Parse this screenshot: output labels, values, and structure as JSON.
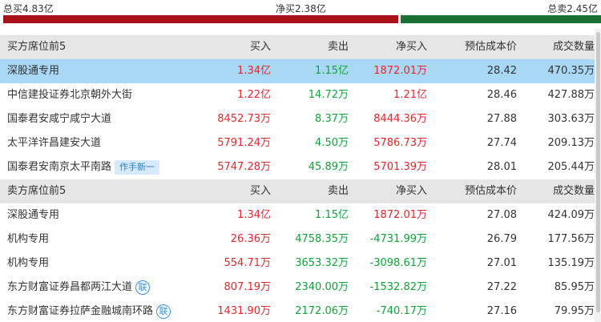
{
  "summary": {
    "total_buy": "总买4.83亿",
    "net_buy": "净买2.38亿",
    "total_sell": "总卖2.45亿",
    "buy_fraction": 0.664,
    "sell_fraction": 0.336
  },
  "colors": {
    "up": "#e8262d",
    "down": "#11a33a",
    "highlight": "#a9d8f5",
    "header": "#e6e6e6"
  },
  "buy_table": {
    "headers": {
      "name": "买方席位前5",
      "buy": "买入",
      "sell": "卖出",
      "net": "净买入",
      "cost": "预估成本价",
      "volume": "成交数量"
    },
    "rows": [
      {
        "name": "深股通专用",
        "buy": "1.34亿",
        "sell": "1.15亿",
        "net": "1872.01万",
        "cost": "28.42",
        "volume": "470.35万"
      },
      {
        "name": "中信建投证券北京朝外大街",
        "buy": "1.22亿",
        "sell": "14.72万",
        "net": "1.21亿",
        "cost": "28.46",
        "volume": "427.88万"
      },
      {
        "name": "国泰君安咸宁咸宁大道",
        "buy": "8452.73万",
        "sell": "8.37万",
        "net": "8444.36万",
        "cost": "27.88",
        "volume": "303.63万"
      },
      {
        "name": "太平洋许昌建安大道",
        "buy": "5791.24万",
        "sell": "4.50万",
        "net": "5786.73万",
        "cost": "27.74",
        "volume": "209.13万"
      },
      {
        "name": "国泰君安南京太平南路",
        "tag": "作手新一",
        "buy": "5747.28万",
        "sell": "45.89万",
        "net": "5701.39万",
        "cost": "28.01",
        "volume": "205.44万"
      }
    ]
  },
  "sell_table": {
    "headers": {
      "name": "卖方席位前5",
      "buy": "买入",
      "sell": "卖出",
      "net": "净买入",
      "cost": "预估成本价",
      "volume": "成交数量"
    },
    "rows": [
      {
        "name": "深股通专用",
        "buy": "1.34亿",
        "sell": "1.15亿",
        "net": "1872.01万",
        "cost": "27.08",
        "volume": "424.09万"
      },
      {
        "name": "机构专用",
        "buy": "26.36万",
        "sell": "4758.35万",
        "net": "-4731.99万",
        "cost": "26.79",
        "volume": "177.56万"
      },
      {
        "name": "机构专用",
        "buy": "554.71万",
        "sell": "3653.32万",
        "net": "-3098.61万",
        "cost": "27.01",
        "volume": "135.19万"
      },
      {
        "name": "东方财富证券昌都两江大道",
        "badge": "联",
        "buy": "807.19万",
        "sell": "2340.00万",
        "net": "-1532.82万",
        "cost": "27.22",
        "volume": "85.95万"
      },
      {
        "name": "东方财富证券拉萨金融城南环路",
        "badge": "联",
        "buy": "1431.90万",
        "sell": "2172.06万",
        "net": "-740.17万",
        "cost": "27.16",
        "volume": "79.95万"
      }
    ]
  }
}
